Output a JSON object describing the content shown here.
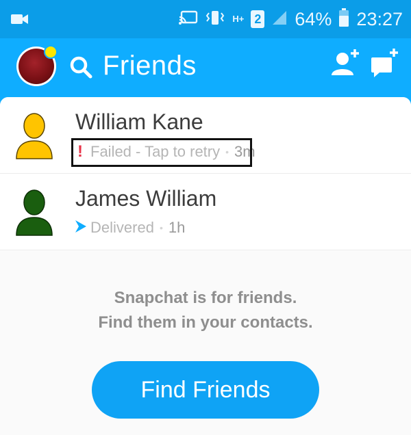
{
  "status_bar": {
    "network_h": "H+",
    "sim": "2",
    "battery": "64%",
    "time": "23:27",
    "icons": [
      "video-camera-icon",
      "cast-icon",
      "vibrate-icon",
      "signal-icon",
      "battery-icon"
    ]
  },
  "header": {
    "title": "Friends",
    "accent": "#0fadff",
    "icons": [
      "avatar",
      "search-icon",
      "add-friend-icon",
      "new-chat-icon"
    ]
  },
  "friends": [
    {
      "name": "William Kane",
      "status": "Failed - Tap to retry",
      "time": "3m",
      "ghost_color": "#ffc400",
      "status_icon": "exclamation-icon"
    },
    {
      "name": "James William",
      "status": "Delivered",
      "time": "1h",
      "ghost_color": "#1a5e0f",
      "status_icon": "delivered-arrow-icon"
    }
  ],
  "empty_state": {
    "line1": "Snapchat is for friends.",
    "line2": "Find them in your contacts."
  },
  "find_button": {
    "label": "Find Friends"
  },
  "colors": {
    "failed": "#e8354a",
    "delivered": "#0fadff"
  }
}
